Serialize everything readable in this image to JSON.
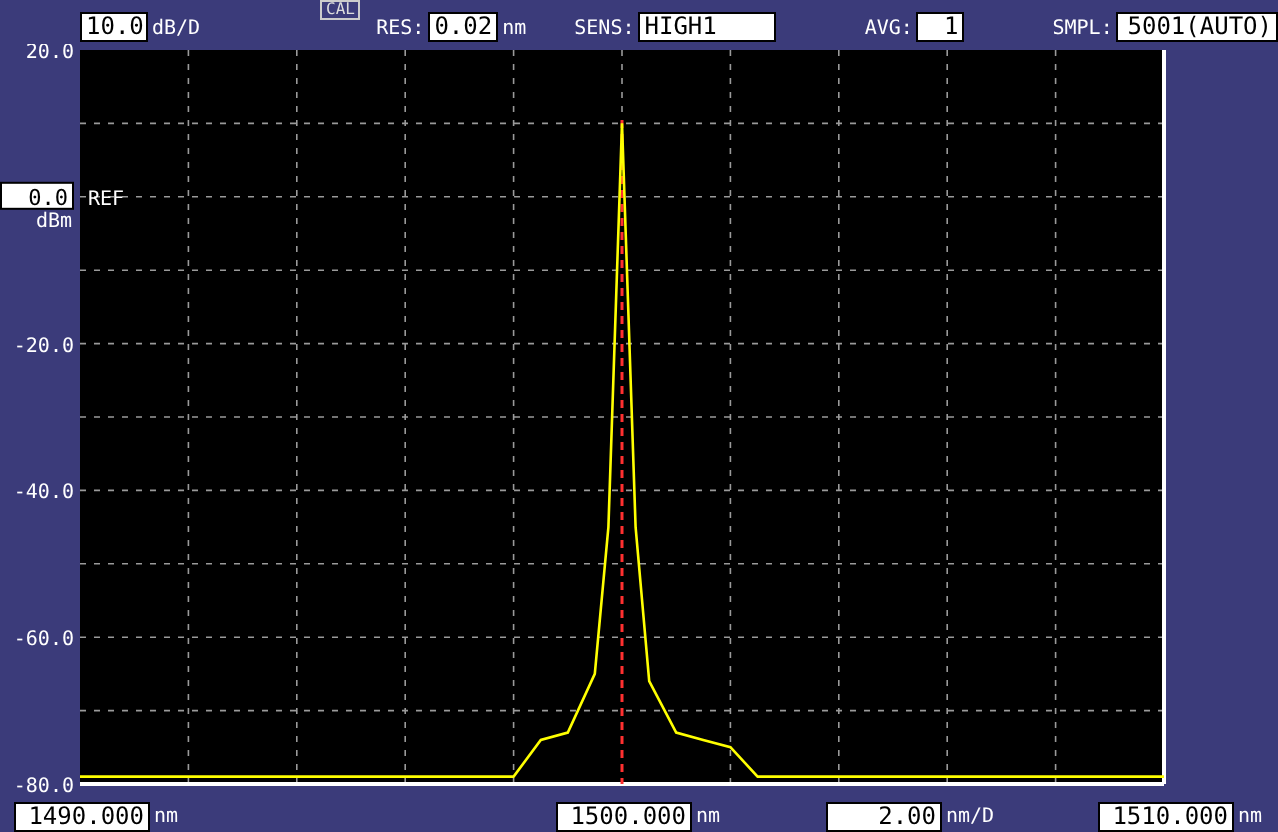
{
  "header": {
    "scale": {
      "value": "10.0",
      "unit": "dB/D"
    },
    "cal_badge": "CAL",
    "settings": [
      {
        "label": "RES:",
        "value": "0.02",
        "unit": "nm"
      },
      {
        "label": "SENS:",
        "value": "HIGH1"
      },
      {
        "label": "AVG:",
        "value": "1"
      },
      {
        "label": "SMPL:",
        "value": "5001(AUTO)"
      }
    ]
  },
  "ref_level": {
    "value": "0.0",
    "label": "REF",
    "unit": "dBm"
  },
  "chart_data": {
    "type": "line",
    "xlim": [
      1490,
      1510
    ],
    "ylim": [
      -80,
      20
    ],
    "xticks": [
      {
        "value": 1490,
        "label": "1490.000"
      },
      {
        "value": 1500,
        "label": "1500.000"
      },
      {
        "value": 1510,
        "label": "1510.000"
      }
    ],
    "yticks": [
      {
        "value": 20,
        "label": "20.0"
      },
      {
        "value": -20,
        "label": "-20.0"
      },
      {
        "value": -40,
        "label": "-40.0"
      },
      {
        "value": -60,
        "label": "-60.0"
      },
      {
        "value": -80,
        "label": "-80.0"
      }
    ],
    "x": [
      1490,
      1492,
      1494,
      1496,
      1498,
      1498.5,
      1499,
      1499.5,
      1499.75,
      1500,
      1500.25,
      1500.5,
      1501,
      1501.5,
      1502,
      1502.5,
      1504,
      1506,
      1508,
      1510
    ],
    "grid": true,
    "ref_lines": [
      {
        "axis": "x",
        "value": 1500,
        "color": "#ff3030"
      }
    ],
    "series": [
      {
        "color": "#ffff00",
        "values": [
          -79,
          -79,
          -79,
          -79,
          -79,
          -74,
          -73,
          -65,
          -45,
          10,
          -45,
          -66,
          -73,
          -74,
          -75,
          -79,
          -79,
          -79,
          -79,
          -79
        ]
      }
    ]
  },
  "x_units": [
    "nm",
    "nm",
    "nm"
  ],
  "span": {
    "value": "2.00",
    "unit": "nm/D"
  }
}
